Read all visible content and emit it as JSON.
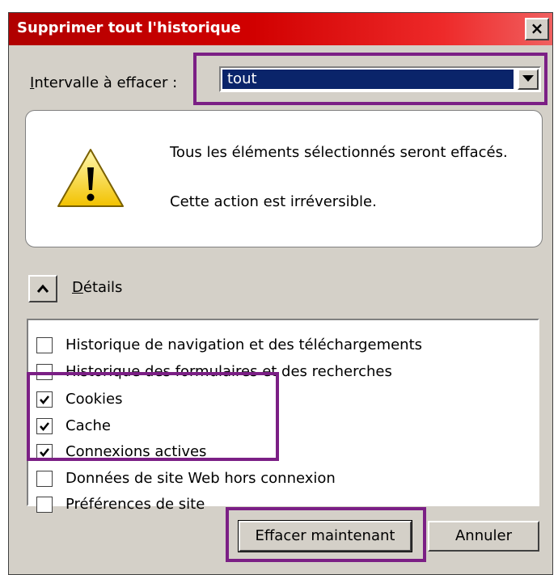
{
  "window": {
    "title": "Supprimer tout l'historique",
    "close_label": "×"
  },
  "interval": {
    "label_prefix": "I",
    "label_rest": "ntervalle à effacer :",
    "selected": "tout"
  },
  "warning": {
    "line1": "Tous les éléments sélectionnés seront effacés.",
    "line2": "Cette action est irréversible."
  },
  "details": {
    "label_prefix": "D",
    "label_rest": "étails",
    "expanded": true
  },
  "items": [
    {
      "label": "Historique de navigation et des téléchargements",
      "checked": false
    },
    {
      "label": "Historique des formulaires et des recherches",
      "checked": false
    },
    {
      "label": "Cookies",
      "checked": true
    },
    {
      "label": "Cache",
      "checked": true
    },
    {
      "label": "Connexions actives",
      "checked": true
    },
    {
      "label": "Données de site Web hors connexion",
      "checked": false
    },
    {
      "label": "Préférences de site",
      "checked": false
    }
  ],
  "buttons": {
    "clear_now": "Effacer maintenant",
    "cancel": "Annuler"
  },
  "colors": {
    "title_bar": "#d10000",
    "highlight": "#7b1f85",
    "dialog_bg": "#d4d0c8",
    "selection": "#0a246a"
  }
}
